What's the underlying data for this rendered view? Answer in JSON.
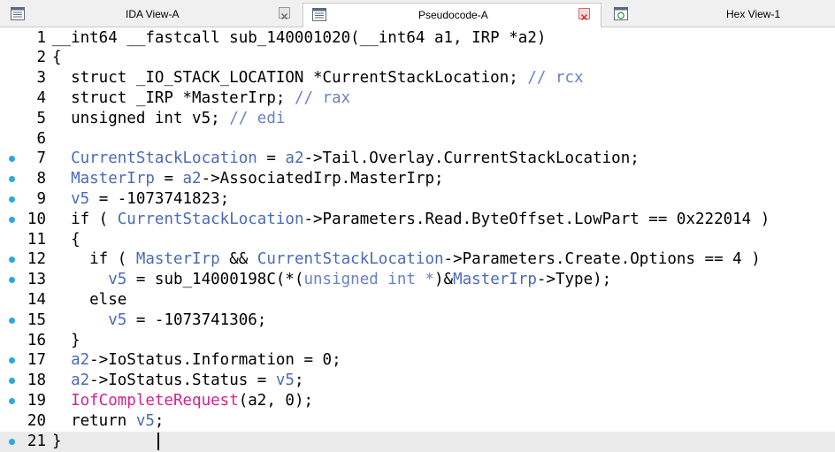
{
  "tabs": [
    {
      "label": "IDA View-A",
      "icon": "ida-view-icon",
      "active": false
    },
    {
      "label": "Pseudocode-A",
      "icon": "pseudocode-icon",
      "active": true
    },
    {
      "label": "Hex View-1",
      "icon": "hex-view-icon",
      "active": false
    }
  ],
  "lines": [
    {
      "n": "1",
      "dot": false,
      "seg": [
        {
          "t": "__int64 __fastcall sub_140001020(__int64 a1, IRP *a2)",
          "k": ""
        }
      ]
    },
    {
      "n": "2",
      "dot": false,
      "seg": [
        {
          "t": "{",
          "k": ""
        }
      ]
    },
    {
      "n": "3",
      "dot": false,
      "seg": [
        {
          "t": "  struct _IO_STACK_LOCATION *CurrentStackLocation; ",
          "k": ""
        },
        {
          "t": "// rcx",
          "k": "c"
        }
      ]
    },
    {
      "n": "4",
      "dot": false,
      "seg": [
        {
          "t": "  struct _IRP *MasterIrp; ",
          "k": ""
        },
        {
          "t": "// rax",
          "k": "c"
        }
      ]
    },
    {
      "n": "5",
      "dot": false,
      "seg": [
        {
          "t": "  unsigned int v5; ",
          "k": ""
        },
        {
          "t": "// edi",
          "k": "c"
        }
      ]
    },
    {
      "n": "6",
      "dot": false,
      "seg": [
        {
          "t": "",
          "k": ""
        }
      ]
    },
    {
      "n": "7",
      "dot": true,
      "seg": [
        {
          "t": "  ",
          "k": ""
        },
        {
          "t": "CurrentStackLocation",
          "k": "v"
        },
        {
          "t": " = ",
          "k": ""
        },
        {
          "t": "a2",
          "k": "v"
        },
        {
          "t": "->Tail.Overlay.CurrentStackLocation;",
          "k": ""
        }
      ]
    },
    {
      "n": "8",
      "dot": true,
      "seg": [
        {
          "t": "  ",
          "k": ""
        },
        {
          "t": "MasterIrp",
          "k": "v"
        },
        {
          "t": " = ",
          "k": ""
        },
        {
          "t": "a2",
          "k": "v"
        },
        {
          "t": "->AssociatedIrp.MasterIrp;",
          "k": ""
        }
      ]
    },
    {
      "n": "9",
      "dot": true,
      "seg": [
        {
          "t": "  ",
          "k": ""
        },
        {
          "t": "v5",
          "k": "v"
        },
        {
          "t": " = -1073741823;",
          "k": ""
        }
      ]
    },
    {
      "n": "10",
      "dot": true,
      "seg": [
        {
          "t": "  if ( ",
          "k": ""
        },
        {
          "t": "CurrentStackLocation",
          "k": "v"
        },
        {
          "t": "->Parameters.Read.ByteOffset.LowPart == 0x222014 )",
          "k": ""
        }
      ]
    },
    {
      "n": "11",
      "dot": false,
      "seg": [
        {
          "t": "  {",
          "k": ""
        }
      ]
    },
    {
      "n": "12",
      "dot": true,
      "seg": [
        {
          "t": "    if ( ",
          "k": ""
        },
        {
          "t": "MasterIrp",
          "k": "v"
        },
        {
          "t": " && ",
          "k": ""
        },
        {
          "t": "CurrentStackLocation",
          "k": "v"
        },
        {
          "t": "->Parameters.Create.Options == 4 )",
          "k": ""
        }
      ]
    },
    {
      "n": "13",
      "dot": true,
      "seg": [
        {
          "t": "      ",
          "k": ""
        },
        {
          "t": "v5",
          "k": "v"
        },
        {
          "t": " = sub_14000198C(*(",
          "k": ""
        },
        {
          "t": "unsigned int *",
          "k": "c"
        },
        {
          "t": ")&",
          "k": ""
        },
        {
          "t": "MasterIrp",
          "k": "v"
        },
        {
          "t": "->Type);",
          "k": ""
        }
      ]
    },
    {
      "n": "14",
      "dot": false,
      "seg": [
        {
          "t": "    else",
          "k": ""
        }
      ]
    },
    {
      "n": "15",
      "dot": true,
      "seg": [
        {
          "t": "      ",
          "k": ""
        },
        {
          "t": "v5",
          "k": "v"
        },
        {
          "t": " = -1073741306;",
          "k": ""
        }
      ]
    },
    {
      "n": "16",
      "dot": false,
      "seg": [
        {
          "t": "  }",
          "k": ""
        }
      ]
    },
    {
      "n": "17",
      "dot": true,
      "seg": [
        {
          "t": "  ",
          "k": ""
        },
        {
          "t": "a2",
          "k": "v"
        },
        {
          "t": "->IoStatus.Information = 0;",
          "k": ""
        }
      ]
    },
    {
      "n": "18",
      "dot": true,
      "seg": [
        {
          "t": "  ",
          "k": ""
        },
        {
          "t": "a2",
          "k": "v"
        },
        {
          "t": "->IoStatus.Status = ",
          "k": ""
        },
        {
          "t": "v5",
          "k": "v"
        },
        {
          "t": ";",
          "k": ""
        }
      ]
    },
    {
      "n": "19",
      "dot": true,
      "seg": [
        {
          "t": "  ",
          "k": ""
        },
        {
          "t": "IofCompleteRequest",
          "k": "f"
        },
        {
          "t": "(a2, 0);",
          "k": ""
        }
      ]
    },
    {
      "n": "20",
      "dot": false,
      "seg": [
        {
          "t": "  return ",
          "k": ""
        },
        {
          "t": "v5",
          "k": "v"
        },
        {
          "t": ";",
          "k": ""
        }
      ]
    },
    {
      "n": "21",
      "dot": true,
      "current": true,
      "seg": [
        {
          "t": "}",
          "k": ""
        }
      ]
    }
  ],
  "colors": {
    "accent": "#2aa9e0",
    "variable": "#4a6ab8",
    "comment": "#6a80c8",
    "import_func": "#d6218e",
    "current_line": "#ebebeb"
  }
}
